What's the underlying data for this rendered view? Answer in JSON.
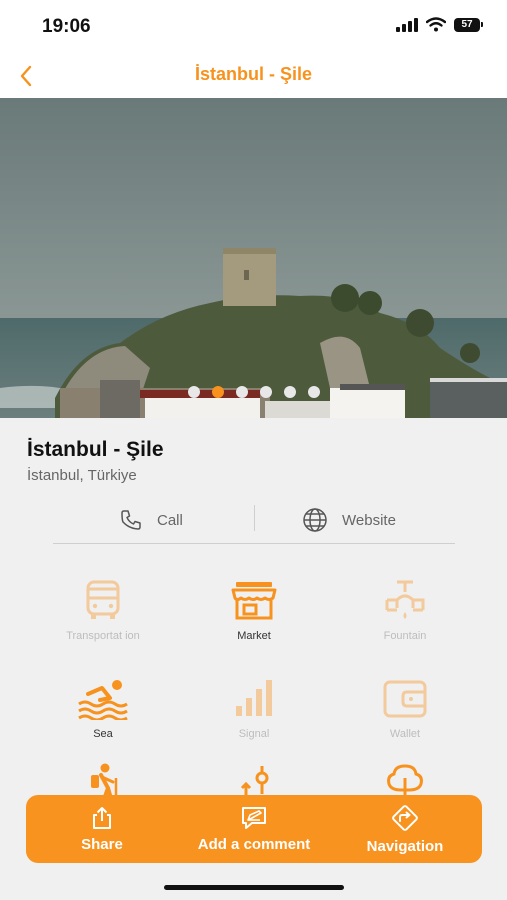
{
  "status_bar": {
    "time": "19:06",
    "battery": "57"
  },
  "nav": {
    "title": "İstanbul - Şile"
  },
  "carousel": {
    "dot_count": 6,
    "active_index": 1
  },
  "place": {
    "name": "İstanbul - Şile",
    "location": "İstanbul, Türkiye"
  },
  "contact": {
    "call_label": "Call",
    "website_label": "Website"
  },
  "features": [
    {
      "label": "Transportat ion",
      "icon": "bus-icon",
      "enabled": false
    },
    {
      "label": "Market",
      "icon": "market-icon",
      "enabled": true
    },
    {
      "label": "Fountain",
      "icon": "fountain-icon",
      "enabled": false
    },
    {
      "label": "Sea",
      "icon": "swimming-icon",
      "enabled": true
    },
    {
      "label": "Signal",
      "icon": "signal-icon",
      "enabled": false
    },
    {
      "label": "Wallet",
      "icon": "wallet-icon",
      "enabled": false
    },
    {
      "label": "",
      "icon": "hiking-icon",
      "enabled": true
    },
    {
      "label": "",
      "icon": "fishing-icon",
      "enabled": true
    },
    {
      "label": "",
      "icon": "tree-icon",
      "enabled": true
    }
  ],
  "actions": {
    "share": "Share",
    "comment": "Add a comment",
    "navigation": "Navigation"
  },
  "colors": {
    "accent": "#f7921e"
  }
}
